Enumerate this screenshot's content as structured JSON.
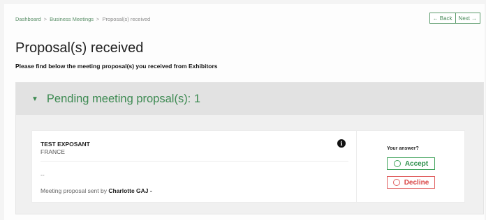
{
  "breadcrumb": {
    "items": [
      "Dashboard",
      "Business Meetings",
      "Proposal(s) received"
    ],
    "separator": ">"
  },
  "nav": {
    "back_label": "Back",
    "back_arrow": "←",
    "next_label": "Next",
    "next_arrow": "→"
  },
  "page": {
    "title": "Proposal(s) received",
    "subtitle": "Please find below the meeting proposal(s) you received from Exhibitors"
  },
  "pending": {
    "caret": "▼",
    "title": "Pending meeting propsal(s): 1"
  },
  "proposal": {
    "company": "TEST EXPOSANT",
    "country": "FRANCE",
    "info_glyph": "i",
    "placeholder": "--",
    "sent_by_prefix": "Meeting proposal sent by",
    "sender": "Charlotte GAJ -",
    "answer_label": "Your answer?",
    "accept_label": "Accept",
    "decline_label": "Decline"
  },
  "colors": {
    "accent_green": "#3d8a52",
    "decline_red": "#d94444"
  }
}
